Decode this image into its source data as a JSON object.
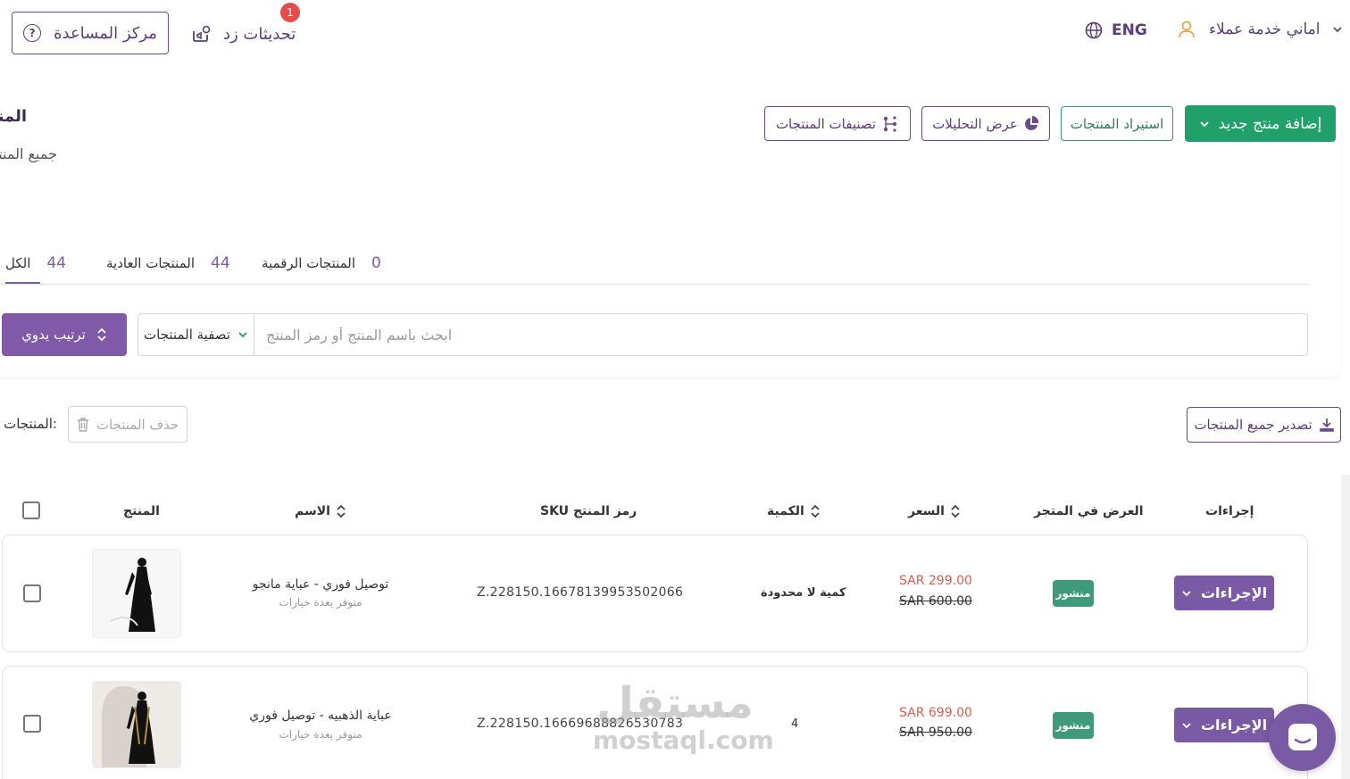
{
  "topbar": {
    "help_label": "مركز المساعدة",
    "help_icon_glyph": "?",
    "updates_label": "تحديثات زد",
    "updates_badge": "1",
    "language": "ENG",
    "user_name": "اماني خدمة عملاء"
  },
  "page": {
    "title": "المنتجات",
    "subtitle": "جميع المنتجات"
  },
  "actions": {
    "add_product": "إضافة منتج جديد",
    "import_products": "استيراد المنتجات",
    "view_analytics": "عرض التحليلات",
    "categories": "تصنيفات المنتجات"
  },
  "tabs": [
    {
      "label": "الكل",
      "count": "44"
    },
    {
      "label": "المنتجات العادية",
      "count": "44"
    },
    {
      "label": "المنتجات الرقمية",
      "count": "0"
    }
  ],
  "search": {
    "placeholder": "ابحث باسم المنتج أو رمز المنتج",
    "filter_label": "تصفية المنتجات",
    "sort_label": "ترتيب يدوي"
  },
  "bulk": {
    "selected_label": ":المنتجات المحددة",
    "delete_label": "حذف المنتجات",
    "export_label": "تصدير جميع المنتجات"
  },
  "table": {
    "headers": {
      "product": "المنتج",
      "name": "الاسم",
      "sku": "SKU رمز المنتج",
      "quantity": "الكمية",
      "price": "السعر",
      "store_display": "العرض في المتجر",
      "actions": "إجراءات"
    },
    "rows": [
      {
        "name": "توصيل فوري - عباية مانجو",
        "sub": "متوفر بعدة خيارات",
        "sku": "Z.228150.16678139953502066",
        "quantity": "كمية لا محدودة",
        "price": "SAR 299.00",
        "old_price": "SAR 600.00",
        "status": "منشور",
        "action_label": "الإجراءات"
      },
      {
        "name": "عباية الذهبيه - توصيل فوري",
        "sub": "متوفر بعدة خيارات",
        "sku": "Z.228150.16669688826530783",
        "quantity": "4",
        "price": "SAR 699.00",
        "old_price": "SAR 950.00",
        "status": "منشور",
        "action_label": "الإجراءات"
      }
    ]
  },
  "watermark": {
    "arabic": "مستقل",
    "latin": "mostaql.com"
  },
  "colors": {
    "primary_purple": "#7a5aa5",
    "green": "#22a06b",
    "price_red": "#e05a4f"
  }
}
